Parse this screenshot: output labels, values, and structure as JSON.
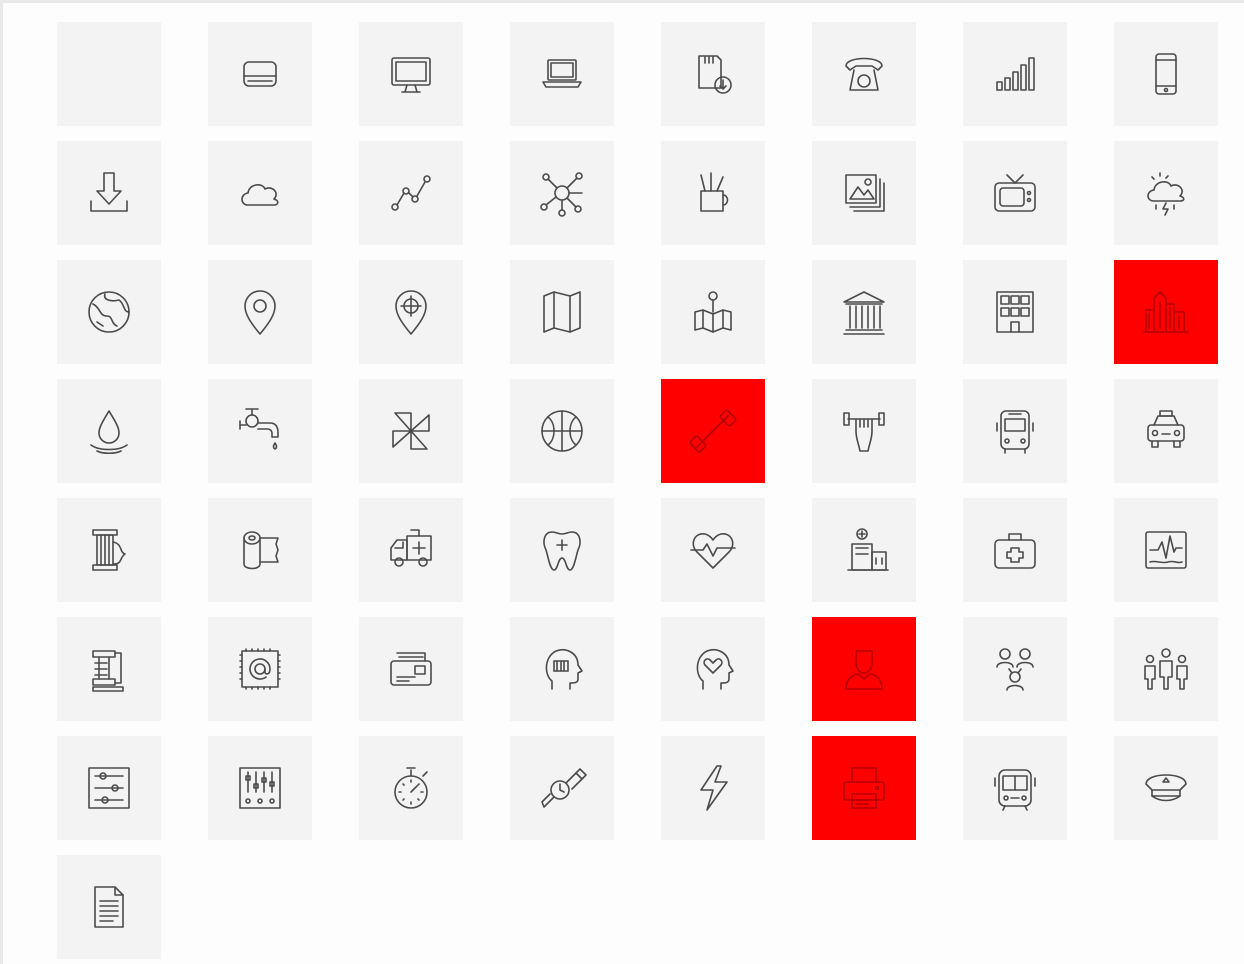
{
  "colors": {
    "tile_background": "#f4f3f4",
    "tile_selected": "#ff0000",
    "icon_stroke": "#4a4a4a"
  },
  "icons": [
    {
      "name": "blank",
      "selected": false
    },
    {
      "name": "hard-drive",
      "selected": false
    },
    {
      "name": "desktop-monitor",
      "selected": false
    },
    {
      "name": "laptop",
      "selected": false
    },
    {
      "name": "sd-card-download",
      "selected": false
    },
    {
      "name": "rotary-telephone",
      "selected": false
    },
    {
      "name": "signal-bars",
      "selected": false
    },
    {
      "name": "smartphone",
      "selected": false
    },
    {
      "name": "download",
      "selected": false
    },
    {
      "name": "cloud",
      "selected": false
    },
    {
      "name": "line-graph",
      "selected": false
    },
    {
      "name": "network-nodes",
      "selected": false
    },
    {
      "name": "pencil-cup",
      "selected": false
    },
    {
      "name": "image-gallery",
      "selected": false
    },
    {
      "name": "retro-tv",
      "selected": false
    },
    {
      "name": "thunderstorm-weather",
      "selected": false
    },
    {
      "name": "globe",
      "selected": false
    },
    {
      "name": "map-pin",
      "selected": false
    },
    {
      "name": "target-pin",
      "selected": false
    },
    {
      "name": "folded-map",
      "selected": false
    },
    {
      "name": "map-location",
      "selected": false
    },
    {
      "name": "bank-building",
      "selected": false
    },
    {
      "name": "office-building",
      "selected": false
    },
    {
      "name": "city-skyline",
      "selected": true
    },
    {
      "name": "water-drop",
      "selected": false
    },
    {
      "name": "water-tap",
      "selected": false
    },
    {
      "name": "pinwheel",
      "selected": false
    },
    {
      "name": "basketball",
      "selected": false
    },
    {
      "name": "dumbbell",
      "selected": true
    },
    {
      "name": "weightlifting",
      "selected": false
    },
    {
      "name": "bus-front",
      "selected": false
    },
    {
      "name": "taxi",
      "selected": false
    },
    {
      "name": "thread-spool",
      "selected": false
    },
    {
      "name": "paper-towel-roll",
      "selected": false
    },
    {
      "name": "ambulance",
      "selected": false
    },
    {
      "name": "tooth",
      "selected": false
    },
    {
      "name": "heartbeat",
      "selected": false
    },
    {
      "name": "hospital",
      "selected": false
    },
    {
      "name": "first-aid-kit",
      "selected": false
    },
    {
      "name": "heart-monitor",
      "selected": false
    },
    {
      "name": "clamp",
      "selected": false
    },
    {
      "name": "email-stamp",
      "selected": false
    },
    {
      "name": "card-reader",
      "selected": false
    },
    {
      "name": "head-barcode",
      "selected": false
    },
    {
      "name": "head-heart",
      "selected": false
    },
    {
      "name": "user-profile",
      "selected": true
    },
    {
      "name": "user-group",
      "selected": false
    },
    {
      "name": "team-people",
      "selected": false
    },
    {
      "name": "sliders-settings",
      "selected": false
    },
    {
      "name": "mixer-equalizer",
      "selected": false
    },
    {
      "name": "stopwatch",
      "selected": false
    },
    {
      "name": "smartwatch",
      "selected": false
    },
    {
      "name": "lightning",
      "selected": false
    },
    {
      "name": "printer",
      "selected": true
    },
    {
      "name": "tram",
      "selected": false
    },
    {
      "name": "police-cap",
      "selected": false
    },
    {
      "name": "document",
      "selected": false
    }
  ]
}
